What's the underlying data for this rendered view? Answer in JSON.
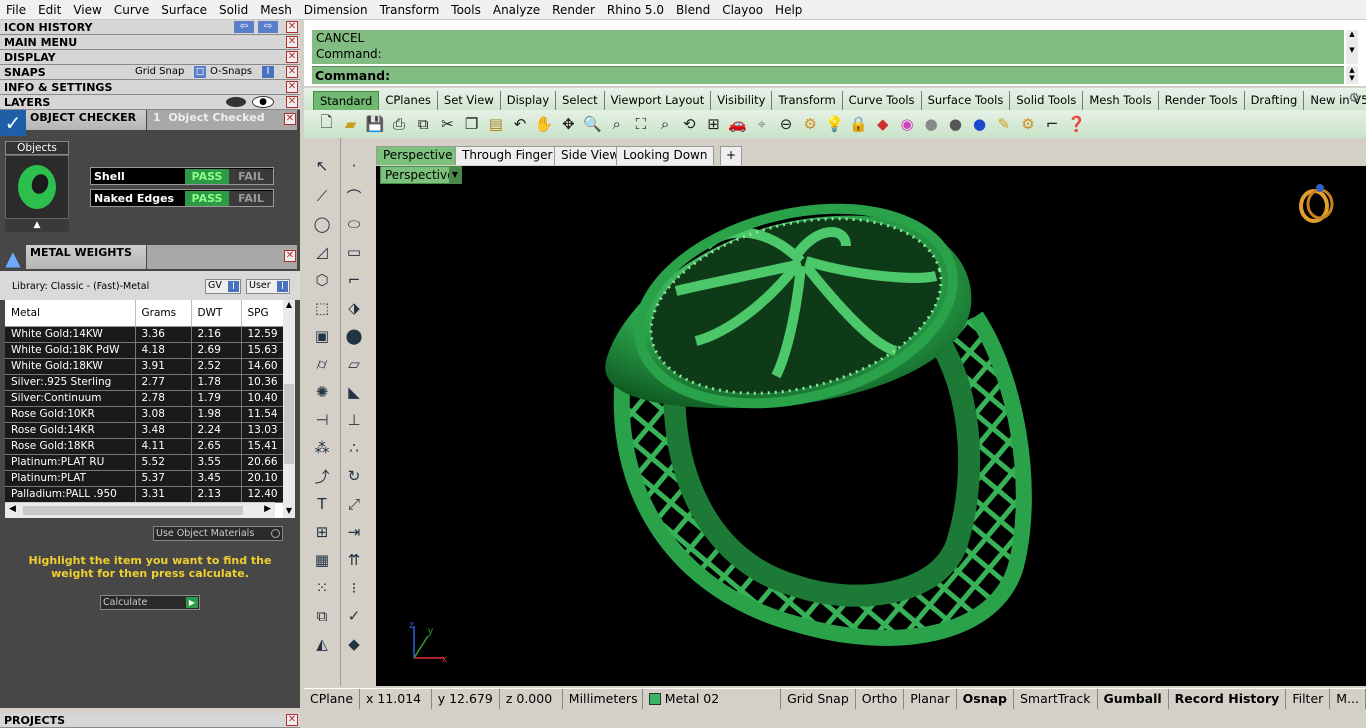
{
  "menu": [
    "File",
    "Edit",
    "View",
    "Curve",
    "Surface",
    "Solid",
    "Mesh",
    "Dimension",
    "Transform",
    "Tools",
    "Analyze",
    "Render",
    "Rhino 5.0",
    "Blend",
    "Clayoo",
    "Help"
  ],
  "left": {
    "sections": [
      "ICON HISTORY",
      "MAIN MENU",
      "DISPLAY",
      "SNAPS",
      "INFO & SETTINGS",
      "LAYERS"
    ],
    "snaps_grid": "Grid Snap",
    "snaps_osnaps": "O-Snaps",
    "snaps_i": "I",
    "object_checker": {
      "title": "OBJECT CHECKER",
      "count": "1",
      "count_label": "Object Checked",
      "objects_tab": "Objects",
      "rows": [
        {
          "label": "Shell",
          "pass": "PASS",
          "fail": "FAIL"
        },
        {
          "label": "Naked Edges",
          "pass": "PASS",
          "fail": "FAIL"
        }
      ]
    },
    "metal_weights": {
      "title": "METAL WEIGHTS",
      "library": "Library: Classic - (Fast)-Metal",
      "gv": "GV",
      "user": "User",
      "toggle": "I",
      "columns": [
        "Metal",
        "Grams",
        "DWT",
        "SPG"
      ],
      "rows": [
        [
          "White Gold:14KW",
          "3.36",
          "2.16",
          "12.59"
        ],
        [
          "White Gold:18K PdW",
          "4.18",
          "2.69",
          "15.63"
        ],
        [
          "White Gold:18KW",
          "3.91",
          "2.52",
          "14.60"
        ],
        [
          "Silver:.925 Sterling",
          "2.77",
          "1.78",
          "10.36"
        ],
        [
          "Silver:Continuum",
          "2.78",
          "1.79",
          "10.40"
        ],
        [
          "Rose Gold:10KR",
          "3.08",
          "1.98",
          "11.54"
        ],
        [
          "Rose Gold:14KR",
          "3.48",
          "2.24",
          "13.03"
        ],
        [
          "Rose Gold:18KR",
          "4.11",
          "2.65",
          "15.41"
        ],
        [
          "Platinum:PLAT RU",
          "5.52",
          "3.55",
          "20.66"
        ],
        [
          "Platinum:PLAT",
          "5.37",
          "3.45",
          "20.10"
        ],
        [
          "Palladium:PALL .950",
          "3.31",
          "2.13",
          "12.40"
        ]
      ],
      "use_materials": "Use Object Materials",
      "instructions": "Highlight the item you want to find the weight for then press calculate.",
      "calculate": "Calculate"
    },
    "projects": "PROJECTS"
  },
  "command": {
    "history": [
      "CANCEL",
      "Command:"
    ],
    "prompt": "Command:"
  },
  "tabs": [
    "Standard",
    "CPlanes",
    "Set View",
    "Display",
    "Select",
    "Viewport Layout",
    "Visibility",
    "Transform",
    "Curve Tools",
    "Surface Tools",
    "Solid Tools",
    "Mesh Tools",
    "Render Tools",
    "Drafting",
    "New in V5"
  ],
  "toolbar_icons": [
    "new-icon",
    "open-icon",
    "save-icon",
    "print-icon",
    "import-icon",
    "cut-icon",
    "copy-icon",
    "paste-icon",
    "undo-icon",
    "pan-hand-icon",
    "rotate-icon",
    "zoom-icon",
    "zoom-window-icon",
    "zoom-extents-icon",
    "zoom-selected-icon",
    "rotate-view-icon",
    "four-viewports-icon",
    "car-icon",
    "camera-icon",
    "grid-icon",
    "gear-cplane-icon",
    "light-icon",
    "lock-icon",
    "layer-icon",
    "color-wheel-icon",
    "material-icon",
    "render-sphere-icon",
    "render-blue-icon",
    "brush-icon",
    "settings-icon",
    "snap-icon",
    "help-icon"
  ],
  "viewport": {
    "tabs": [
      "Perspective",
      "Through Finger",
      "Side View",
      "Looking Down"
    ],
    "label": "Perspective",
    "axes": {
      "x": "x",
      "y": "y",
      "z": "z"
    }
  },
  "status": {
    "cplane": "CPlane",
    "x": "x 11.014",
    "y": "y 12.679",
    "z": "z 0.000",
    "units": "Millimeters",
    "layer": "Metal 02",
    "layer_color": "#3cb468",
    "toggles": [
      {
        "label": "Grid Snap",
        "bold": false
      },
      {
        "label": "Ortho",
        "bold": false
      },
      {
        "label": "Planar",
        "bold": false
      },
      {
        "label": "Osnap",
        "bold": true
      },
      {
        "label": "SmartTrack",
        "bold": false
      },
      {
        "label": "Gumball",
        "bold": true
      },
      {
        "label": "Record History",
        "bold": true
      },
      {
        "label": "Filter",
        "bold": false
      },
      {
        "label": "M...",
        "bold": false
      }
    ]
  }
}
